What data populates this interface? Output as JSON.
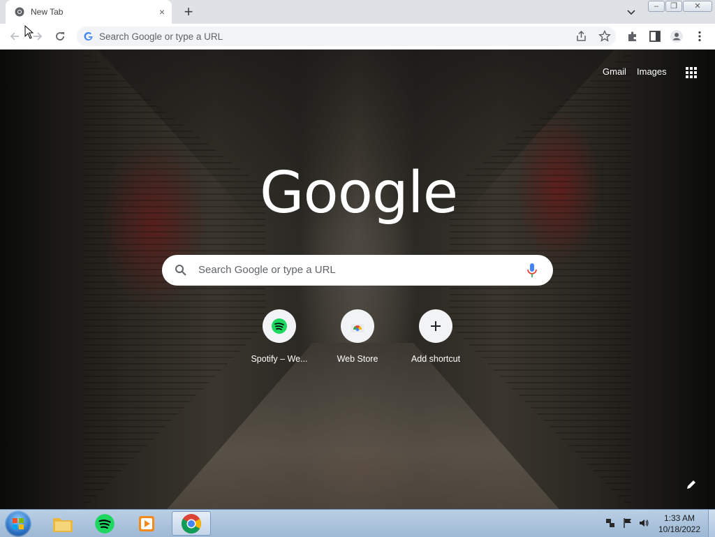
{
  "browser": {
    "tab": {
      "title": "New Tab",
      "close_glyph": "×"
    },
    "new_tab_glyph": "+",
    "window_controls": {
      "minimize": "‒",
      "restore": "❐",
      "close": "✕"
    },
    "omnibox": {
      "placeholder": "Search Google or type a URL"
    }
  },
  "ntp": {
    "links": {
      "gmail": "Gmail",
      "images": "Images"
    },
    "logo": "Google",
    "search": {
      "placeholder": "Search Google or type a URL"
    },
    "shortcuts": [
      {
        "label": "Spotify – We...",
        "icon": "spotify-icon"
      },
      {
        "label": "Web Store",
        "icon": "web-store-icon"
      },
      {
        "label": "Add shortcut",
        "icon": "plus-icon"
      }
    ]
  },
  "taskbar": {
    "items": [
      "start-orb",
      "file-explorer-icon",
      "spotify-icon",
      "media-player-icon",
      "chrome-icon"
    ],
    "clock": {
      "time": "1:33 AM",
      "date": "10/18/2022"
    }
  },
  "colors": {
    "google_blue": "#4285f4",
    "spotify_green": "#1ed760",
    "taskbar": "#a9c3dd"
  }
}
